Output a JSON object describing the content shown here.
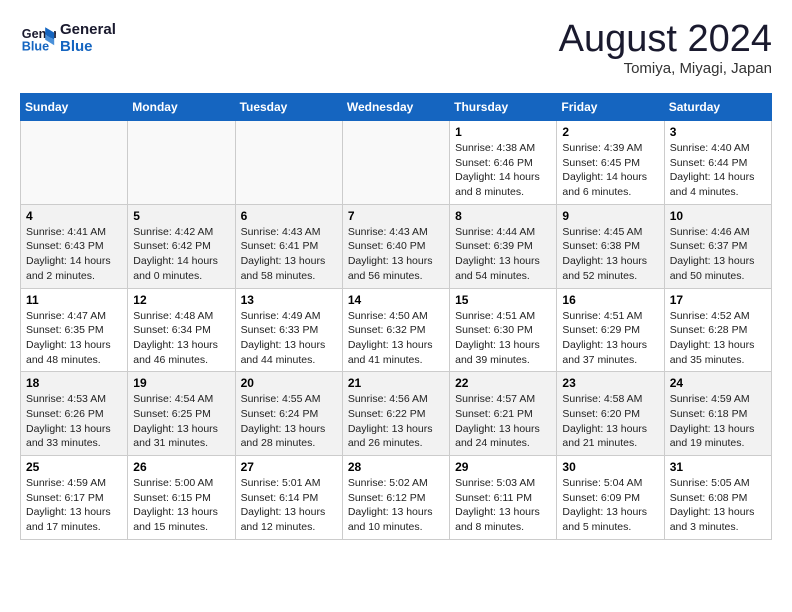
{
  "header": {
    "logo_line1": "General",
    "logo_line2": "Blue",
    "month": "August 2024",
    "location": "Tomiya, Miyagi, Japan"
  },
  "weekdays": [
    "Sunday",
    "Monday",
    "Tuesday",
    "Wednesday",
    "Thursday",
    "Friday",
    "Saturday"
  ],
  "weeks": [
    [
      {
        "day": "",
        "info": ""
      },
      {
        "day": "",
        "info": ""
      },
      {
        "day": "",
        "info": ""
      },
      {
        "day": "",
        "info": ""
      },
      {
        "day": "1",
        "info": "Sunrise: 4:38 AM\nSunset: 6:46 PM\nDaylight: 14 hours\nand 8 minutes."
      },
      {
        "day": "2",
        "info": "Sunrise: 4:39 AM\nSunset: 6:45 PM\nDaylight: 14 hours\nand 6 minutes."
      },
      {
        "day": "3",
        "info": "Sunrise: 4:40 AM\nSunset: 6:44 PM\nDaylight: 14 hours\nand 4 minutes."
      }
    ],
    [
      {
        "day": "4",
        "info": "Sunrise: 4:41 AM\nSunset: 6:43 PM\nDaylight: 14 hours\nand 2 minutes."
      },
      {
        "day": "5",
        "info": "Sunrise: 4:42 AM\nSunset: 6:42 PM\nDaylight: 14 hours\nand 0 minutes."
      },
      {
        "day": "6",
        "info": "Sunrise: 4:43 AM\nSunset: 6:41 PM\nDaylight: 13 hours\nand 58 minutes."
      },
      {
        "day": "7",
        "info": "Sunrise: 4:43 AM\nSunset: 6:40 PM\nDaylight: 13 hours\nand 56 minutes."
      },
      {
        "day": "8",
        "info": "Sunrise: 4:44 AM\nSunset: 6:39 PM\nDaylight: 13 hours\nand 54 minutes."
      },
      {
        "day": "9",
        "info": "Sunrise: 4:45 AM\nSunset: 6:38 PM\nDaylight: 13 hours\nand 52 minutes."
      },
      {
        "day": "10",
        "info": "Sunrise: 4:46 AM\nSunset: 6:37 PM\nDaylight: 13 hours\nand 50 minutes."
      }
    ],
    [
      {
        "day": "11",
        "info": "Sunrise: 4:47 AM\nSunset: 6:35 PM\nDaylight: 13 hours\nand 48 minutes."
      },
      {
        "day": "12",
        "info": "Sunrise: 4:48 AM\nSunset: 6:34 PM\nDaylight: 13 hours\nand 46 minutes."
      },
      {
        "day": "13",
        "info": "Sunrise: 4:49 AM\nSunset: 6:33 PM\nDaylight: 13 hours\nand 44 minutes."
      },
      {
        "day": "14",
        "info": "Sunrise: 4:50 AM\nSunset: 6:32 PM\nDaylight: 13 hours\nand 41 minutes."
      },
      {
        "day": "15",
        "info": "Sunrise: 4:51 AM\nSunset: 6:30 PM\nDaylight: 13 hours\nand 39 minutes."
      },
      {
        "day": "16",
        "info": "Sunrise: 4:51 AM\nSunset: 6:29 PM\nDaylight: 13 hours\nand 37 minutes."
      },
      {
        "day": "17",
        "info": "Sunrise: 4:52 AM\nSunset: 6:28 PM\nDaylight: 13 hours\nand 35 minutes."
      }
    ],
    [
      {
        "day": "18",
        "info": "Sunrise: 4:53 AM\nSunset: 6:26 PM\nDaylight: 13 hours\nand 33 minutes."
      },
      {
        "day": "19",
        "info": "Sunrise: 4:54 AM\nSunset: 6:25 PM\nDaylight: 13 hours\nand 31 minutes."
      },
      {
        "day": "20",
        "info": "Sunrise: 4:55 AM\nSunset: 6:24 PM\nDaylight: 13 hours\nand 28 minutes."
      },
      {
        "day": "21",
        "info": "Sunrise: 4:56 AM\nSunset: 6:22 PM\nDaylight: 13 hours\nand 26 minutes."
      },
      {
        "day": "22",
        "info": "Sunrise: 4:57 AM\nSunset: 6:21 PM\nDaylight: 13 hours\nand 24 minutes."
      },
      {
        "day": "23",
        "info": "Sunrise: 4:58 AM\nSunset: 6:20 PM\nDaylight: 13 hours\nand 21 minutes."
      },
      {
        "day": "24",
        "info": "Sunrise: 4:59 AM\nSunset: 6:18 PM\nDaylight: 13 hours\nand 19 minutes."
      }
    ],
    [
      {
        "day": "25",
        "info": "Sunrise: 4:59 AM\nSunset: 6:17 PM\nDaylight: 13 hours\nand 17 minutes."
      },
      {
        "day": "26",
        "info": "Sunrise: 5:00 AM\nSunset: 6:15 PM\nDaylight: 13 hours\nand 15 minutes."
      },
      {
        "day": "27",
        "info": "Sunrise: 5:01 AM\nSunset: 6:14 PM\nDaylight: 13 hours\nand 12 minutes."
      },
      {
        "day": "28",
        "info": "Sunrise: 5:02 AM\nSunset: 6:12 PM\nDaylight: 13 hours\nand 10 minutes."
      },
      {
        "day": "29",
        "info": "Sunrise: 5:03 AM\nSunset: 6:11 PM\nDaylight: 13 hours\nand 8 minutes."
      },
      {
        "day": "30",
        "info": "Sunrise: 5:04 AM\nSunset: 6:09 PM\nDaylight: 13 hours\nand 5 minutes."
      },
      {
        "day": "31",
        "info": "Sunrise: 5:05 AM\nSunset: 6:08 PM\nDaylight: 13 hours\nand 3 minutes."
      }
    ]
  ]
}
